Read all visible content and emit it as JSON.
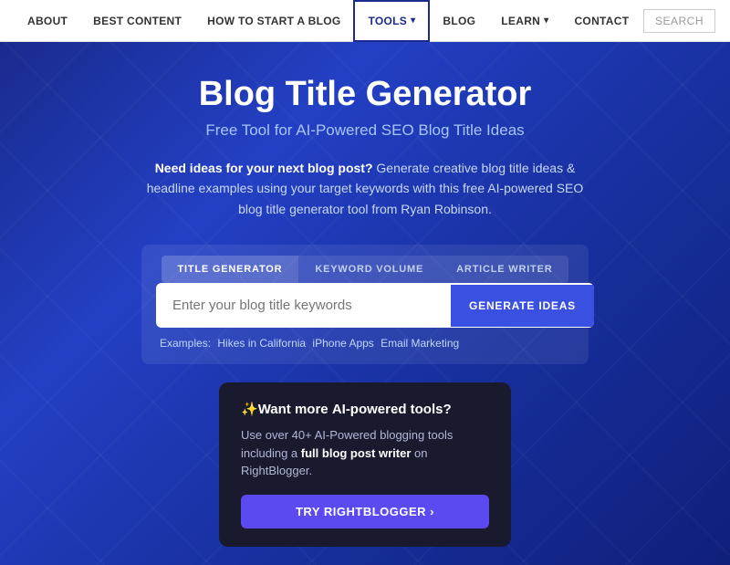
{
  "nav": {
    "items": [
      {
        "label": "ABOUT",
        "active": false,
        "has_dropdown": false
      },
      {
        "label": "BEST CONTENT",
        "active": false,
        "has_dropdown": false
      },
      {
        "label": "HOW TO START A BLOG",
        "active": false,
        "has_dropdown": false
      },
      {
        "label": "TOOLS",
        "active": true,
        "has_dropdown": true
      },
      {
        "label": "BLOG",
        "active": false,
        "has_dropdown": false
      },
      {
        "label": "LEARN",
        "active": false,
        "has_dropdown": true
      },
      {
        "label": "CONTACT",
        "active": false,
        "has_dropdown": false
      }
    ],
    "search_label": "SEARCH"
  },
  "hero": {
    "title": "Blog Title Generator",
    "subtitle": "Free Tool for AI-Powered SEO Blog Title Ideas",
    "description_bold": "Need ideas for your next blog post?",
    "description_rest": " Generate creative blog title ideas & headline examples using your target keywords with this free AI-powered SEO blog title generator tool from Ryan Robinson."
  },
  "tools": {
    "tabs": [
      {
        "label": "TITLE GENERATOR",
        "active": true
      },
      {
        "label": "KEYWORD VOLUME",
        "active": false
      },
      {
        "label": "ARTICLE WRITER",
        "active": false
      }
    ],
    "input_placeholder": "Enter your blog title keywords",
    "generate_button": "GENERATE IDEAS",
    "examples_label": "Examples:",
    "examples": [
      "Hikes in California",
      "iPhone Apps",
      "Email Marketing"
    ]
  },
  "promo": {
    "emoji": "✨",
    "title_start": "Want more ",
    "title_bold": "AI-powered tools",
    "title_end": "?",
    "desc_start": "Use over 40+ AI-Powered blogging tools including a ",
    "desc_bold": "full blog post writer",
    "desc_end": " on RightBlogger.",
    "button_label": "TRY RIGHTBLOGGER",
    "button_arrow": "›"
  }
}
